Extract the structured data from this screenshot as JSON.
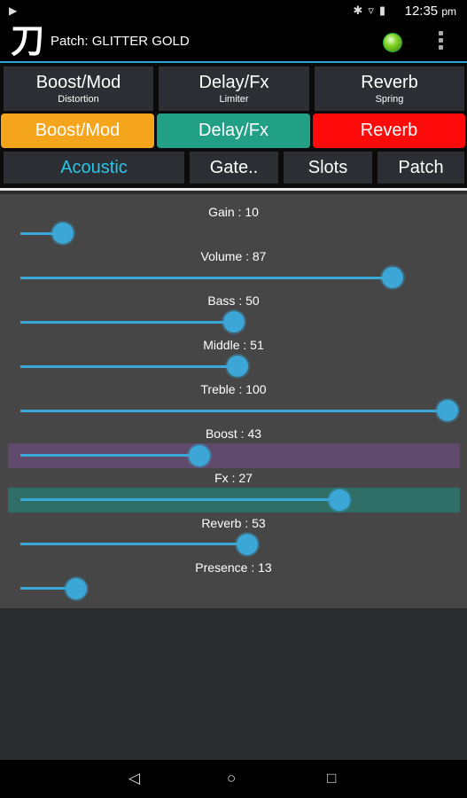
{
  "status_bar": {
    "time": "12:35",
    "time_suffix": "pm",
    "icons": [
      "bluetooth-icon",
      "wifi-icon",
      "battery-icon"
    ]
  },
  "app": {
    "logo": "刀",
    "patch_label": "Patch: GLITTER GOLD"
  },
  "effect_tiles": [
    {
      "title": "Boost/Mod",
      "subtitle": "Distortion"
    },
    {
      "title": "Delay/Fx",
      "subtitle": "Limiter"
    },
    {
      "title": "Reverb",
      "subtitle": "Spring"
    }
  ],
  "effect_toggles": [
    {
      "label": "Boost/Mod",
      "color": "#f5a51b"
    },
    {
      "label": "Delay/Fx",
      "color": "#22a086"
    },
    {
      "label": "Reverb",
      "color": "#ff0a0a"
    }
  ],
  "nav_tabs": [
    {
      "label": "Acoustic",
      "active": true,
      "color": "#29c4e8"
    },
    {
      "label": "Gate..",
      "active": false
    },
    {
      "label": "Slots",
      "active": false
    },
    {
      "label": "Patch",
      "active": false
    }
  ],
  "sliders": [
    {
      "label": "Gain : 10",
      "value": 10
    },
    {
      "label": "Volume  : 87",
      "value": 87
    },
    {
      "label": "Bass  : 50",
      "value": 50
    },
    {
      "label": "Middle  : 51",
      "value": 51
    },
    {
      "label": "Treble  : 100",
      "value": 100
    },
    {
      "label": "Boost : 43",
      "value": 43,
      "band_color": "#5f4a6b"
    },
    {
      "label": "Fx : 27",
      "value": 27,
      "band_color": "#2f6e66"
    },
    {
      "label": "Reverb  : 53",
      "value": 53
    },
    {
      "label": "Presence : 13",
      "value": 13
    }
  ],
  "colors": {
    "accent": "#3aa8d8",
    "boost_band": "#5f4a6b",
    "fx_band": "#2f6e66"
  }
}
